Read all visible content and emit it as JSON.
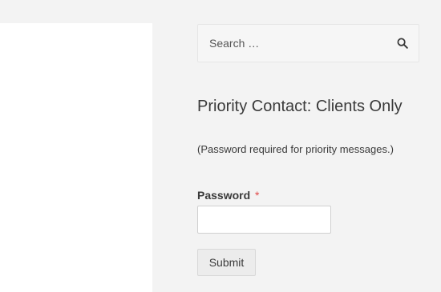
{
  "search": {
    "placeholder": "Search …",
    "icon": "search-icon"
  },
  "widget": {
    "title": "Priority Contact: Clients Only",
    "note": "(Password required for priority messages.)",
    "password_label": "Password",
    "required_marker": "*",
    "submit_label": "Submit"
  },
  "colors": {
    "page_background": "#f3f3f3",
    "content_background": "#ffffff",
    "required_marker": "#e04b4b",
    "text": "#3a3a3a"
  }
}
